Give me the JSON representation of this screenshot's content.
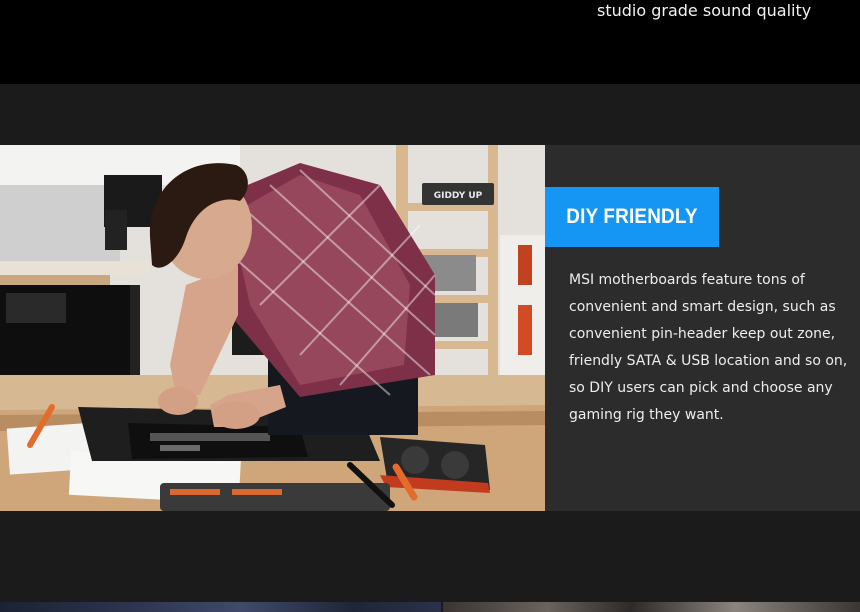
{
  "top": {
    "caption": "studio grade sound quality"
  },
  "feature": {
    "badge": "DIY FRIENDLY",
    "description": "MSI motherboards feature tons of convenient and smart design, such as convenient pin-header keep out zone, friendly SATA & USB location and so on, so DIY users can pick and choose any gaming rig they want.",
    "photo": {
      "shelf_sign": "GIDDY UP"
    },
    "colors": {
      "badge_bg": "#1596f5",
      "panel_bg": "#2c2c2c"
    }
  }
}
